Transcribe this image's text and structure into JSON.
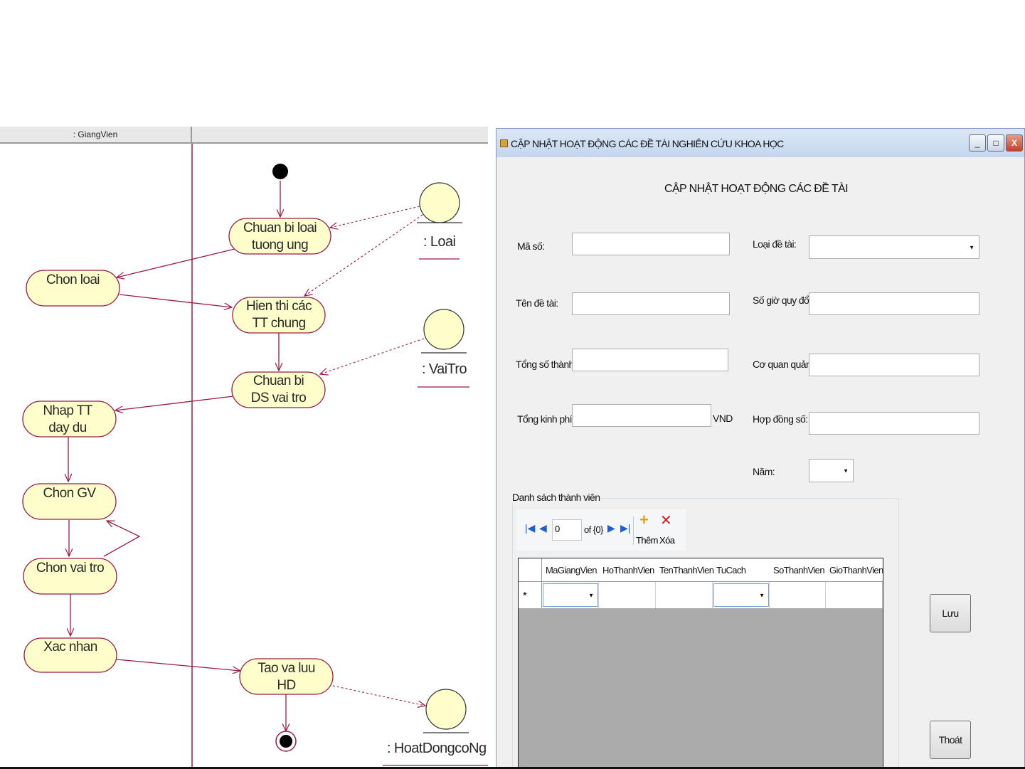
{
  "diagram": {
    "swimlane": ": GiangVien",
    "nodes": [
      {
        "id": "chuan-bi-loai",
        "label": "Chuan bi loai\ntuong ung"
      },
      {
        "id": "chon-loai",
        "label": "Chon loai"
      },
      {
        "id": "hien-thi",
        "label": "Hien thi các\nTT chung"
      },
      {
        "id": "chuan-bi-ds",
        "label": "Chuan bi\nDS vai tro"
      },
      {
        "id": "nhap-tt",
        "label": "Nhap TT\nday du"
      },
      {
        "id": "chon-gv",
        "label": "Chon GV"
      },
      {
        "id": "chon-vai-tro",
        "label": "Chon vai tro"
      },
      {
        "id": "xac-nhan",
        "label": "Xac nhan"
      },
      {
        "id": "tao-va-luu",
        "label": "Tao va luu\nHD"
      }
    ],
    "objects": [
      {
        "id": "loai",
        "label": ": Loai"
      },
      {
        "id": "vaitro",
        "label": ": VaiTro"
      },
      {
        "id": "hoatdong",
        "label": ": HoatDongcoNg"
      }
    ]
  },
  "window": {
    "title": "CẬP NHẬT HOẠT ĐỘNG CÁC ĐỀ TÀI NGHIÊN CỨU KHOA HỌC",
    "heading": "CẬP NHẬT HOẠT ĐỘNG CÁC ĐỀ TÀI",
    "controls": {
      "minimize": "_",
      "maximize": "□",
      "close": "X"
    },
    "labels": {
      "ma_so": "Mã số:",
      "ten_de_tai": "Tên đề tài:",
      "tong_so_thanh_vien": "Tổng số thành viên:",
      "tong_kinh_phi": "Tổng kinh phí:",
      "vnd": "VND",
      "loai_de_tai": "Loại đề tài:",
      "so_gio_quy_doi": "Số giờ quy đổi:",
      "co_quan_quan_ly": "Cơ quan quản lý:",
      "hop_dong_so": "Hợp đồng số:",
      "nam": "Năm:"
    },
    "group_title": "Danh sách thành viên",
    "navigator": {
      "position": "0",
      "count": "of {0}",
      "add_label": "Thêm",
      "delete_label": "Xóa"
    },
    "grid_columns": [
      "MaGiangVien",
      "HoThanhVien",
      "TenThanhVien",
      "TuCach",
      "SoThanhVien",
      "GioThanhVien"
    ],
    "new_row_marker": "*",
    "buttons": {
      "save": "Lưu",
      "exit": "Thoát"
    }
  }
}
